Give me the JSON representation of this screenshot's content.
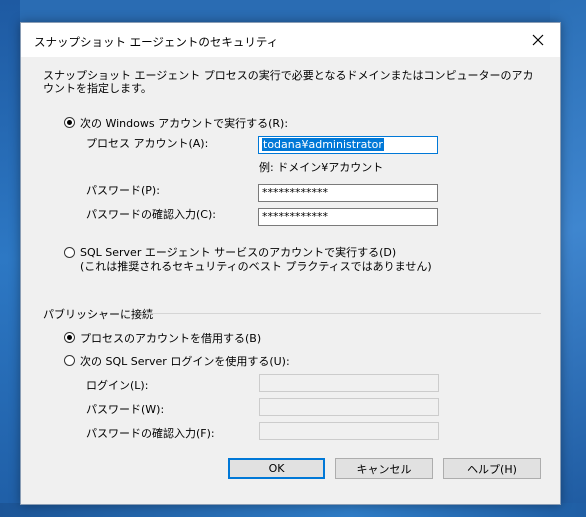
{
  "dialog": {
    "title": "スナップショット エージェントのセキュリティ",
    "description": "スナップショット エージェント プロセスの実行で必要となるドメインまたはコンピューターのアカウントを指定します。"
  },
  "process_account": {
    "option_windows_label": "次の Windows アカウントで実行する(R):",
    "process_account_label": "プロセス アカウント(A):",
    "process_account_value": "todana¥administrator",
    "example_text": "例: ドメイン¥アカウント",
    "password_label": "パスワード(P):",
    "password_value": "************",
    "confirm_password_label": "パスワードの確認入力(C):",
    "confirm_password_value": "************",
    "option_agent_label": "SQL Server エージェント サービスのアカウントで実行する(D)",
    "option_agent_note": "(これは推奨されるセキュリティのベスト プラクティスではありません)"
  },
  "publisher": {
    "group_label": "パブリッシャーに接続",
    "option_impersonate_label": "プロセスのアカウントを借用する(B)",
    "option_sql_login_label": "次の SQL Server ログインを使用する(U):",
    "login_label": "ログイン(L):",
    "password_label": "パスワード(W):",
    "confirm_password_label": "パスワードの確認入力(F):"
  },
  "buttons": {
    "ok": "OK",
    "cancel": "キャンセル",
    "help": "ヘルプ(H)"
  },
  "state": {
    "windows_account_selected": true,
    "impersonate_selected": true
  }
}
